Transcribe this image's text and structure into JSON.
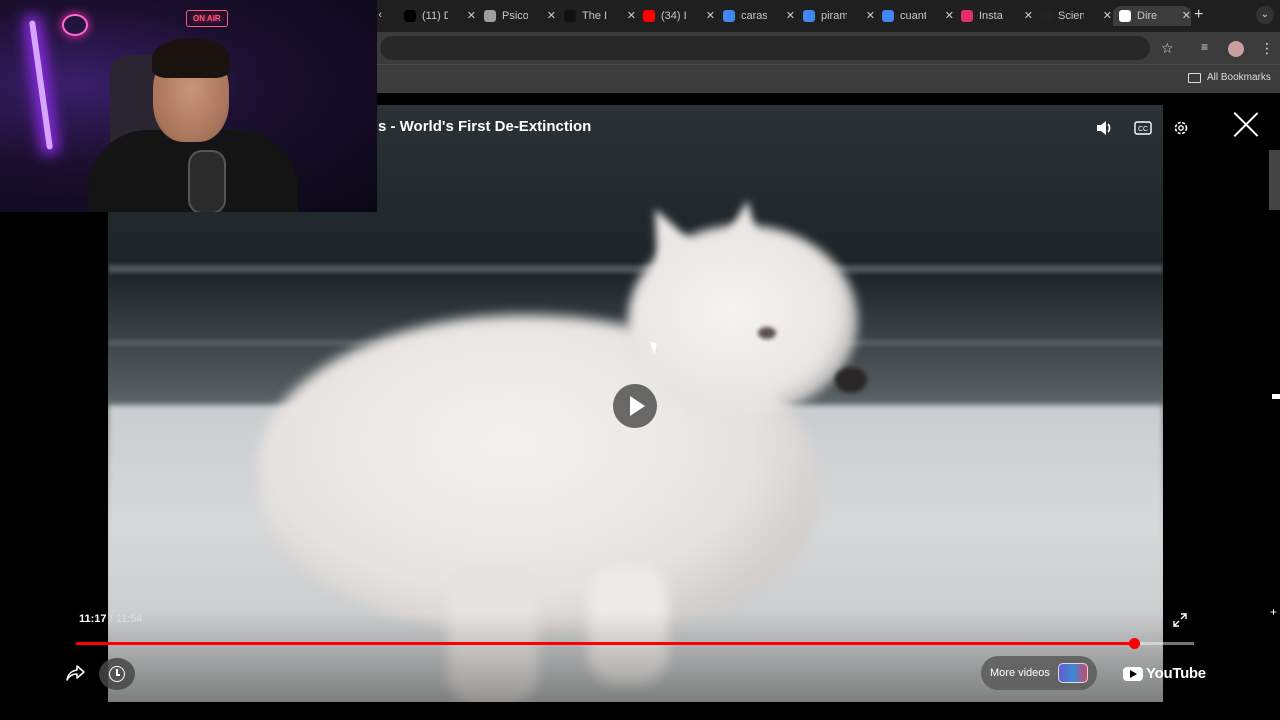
{
  "browser": {
    "tabs": [
      {
        "title": "(11) D",
        "favicon": "x-icon",
        "color": "#000000"
      },
      {
        "title": "Psico",
        "favicon": "globe-icon",
        "color": "#9e9e9e"
      },
      {
        "title": "The I",
        "favicon": "tiktok-icon",
        "color": "#111111"
      },
      {
        "title": "(34) I",
        "favicon": "youtube-icon",
        "color": "#ff0000"
      },
      {
        "title": "caras",
        "favicon": "google-icon",
        "color": "#4285f4"
      },
      {
        "title": "piram",
        "favicon": "google-icon",
        "color": "#4285f4"
      },
      {
        "title": "cuant",
        "favicon": "google-icon",
        "color": "#4285f4"
      },
      {
        "title": "Insta",
        "favicon": "instagram-icon",
        "color": "#e1306c"
      },
      {
        "title": "Scien",
        "favicon": "science-icon",
        "color": "#222222"
      },
      {
        "title": "Dire",
        "favicon": "site-icon",
        "color": "#ffffff"
      }
    ],
    "bookmarks_label": "All Bookmarks"
  },
  "video": {
    "title": "s - World's First De-Extinction",
    "current_time": "11:17",
    "duration": "11:54",
    "progress_fraction": 0.946,
    "more_videos_label": "More videos",
    "brand_label": "YouTube",
    "accent_color": "#ff0000"
  },
  "webcam": {
    "sign_label": "ON AIR"
  }
}
